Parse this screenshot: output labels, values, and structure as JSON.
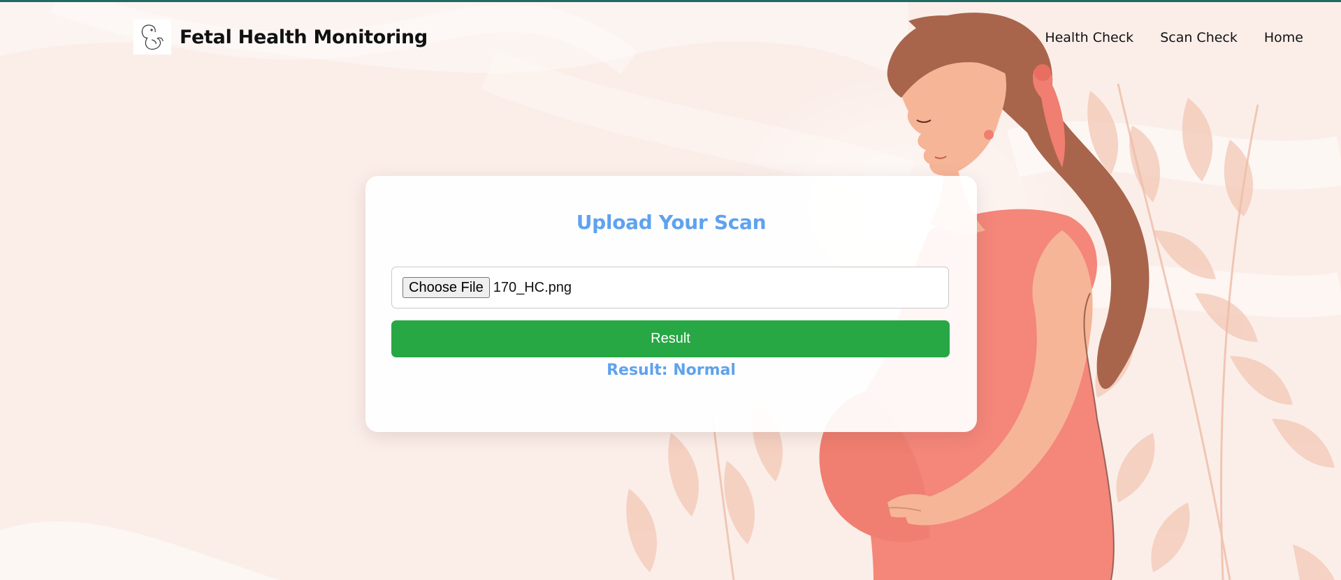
{
  "brand": {
    "title": "Fetal Health Monitoring",
    "logo_icon": "fetus-line-icon"
  },
  "nav": {
    "items": [
      {
        "label": "Health Check"
      },
      {
        "label": "Scan Check"
      },
      {
        "label": "Home"
      }
    ]
  },
  "upload": {
    "title": "Upload Your Scan",
    "choose_file_label": "Choose File",
    "file_name": "170_HC.png",
    "submit_label": "Result",
    "result_text": "Result: Normal"
  },
  "colors": {
    "accent_blue": "#5fa2ee",
    "button_green": "#28a745",
    "background": "#fbeee9",
    "top_rule": "#1f6b63",
    "dress": "#f4867a",
    "hair": "#a8654b",
    "skin": "#f6b597"
  }
}
